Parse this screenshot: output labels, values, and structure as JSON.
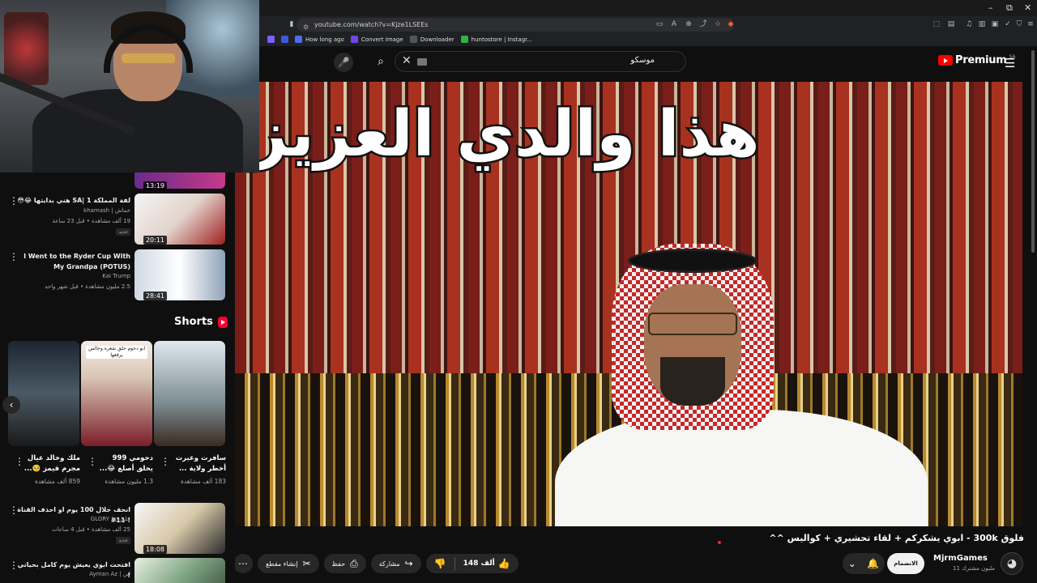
{
  "browser": {
    "url": "youtube.com/watch?v=Kjze1LSEEs",
    "bookmarks": [
      {
        "label": "",
        "color": "#7b61ff"
      },
      {
        "label": "",
        "color": "#3b5bdb"
      },
      {
        "label": "How long ago",
        "color": "#4c6ef5"
      },
      {
        "label": "Convert Image",
        "color": "#7048e8"
      },
      {
        "label": "Downloader",
        "color": "#555555"
      },
      {
        "label": "huntostore | Instagr...",
        "color": "#2fb344"
      }
    ]
  },
  "header": {
    "search_query": "موسكو",
    "logo_text": "Premium",
    "logo_region": "SA"
  },
  "video": {
    "caption": "هذا والدي العزيز",
    "title": "فلوق 300k - ابوي يشكركم + لقاء تحشيري + كواليس ^^",
    "like_count": "148 ألف",
    "share_label": "مشاركة",
    "save_label": "حفظ",
    "clip_label": "إنشاء مقطع"
  },
  "channel": {
    "name": "MjrmGames",
    "subscribers": "11 مليون مشترك",
    "join_label": "الانضمام"
  },
  "sidebar": {
    "partial_item": {
      "duration": "13:19"
    },
    "items": [
      {
        "title": "لفة المملكة 1 |SA هني بدايتها 😂😳",
        "channel": "خماش | khamash",
        "meta": "19 ألف مشاهدة • قبل 23 ساعة",
        "badge": "جديد",
        "duration": "20:11"
      },
      {
        "title": "I Went to the Ryder Cup With My Grandpa (POTUS)",
        "channel": "Kai Trump",
        "meta": "2.5 مليون مشاهدة • قبل شهر واحد",
        "badge": "",
        "duration": "28:41"
      },
      {
        "title": "انحف خلال 100 يوم او احذف القناة ! 11#",
        "channel": "جلوري | GLORY",
        "meta": "25 ألف مشاهدة • قبل 4 ساعات",
        "badge": "جديد",
        "duration": "18:08"
      },
      {
        "title": "افتحت ابوي يعيش يوم كامل بحياتي !",
        "channel": "ابن | Ayman Az",
        "meta": "",
        "badge": "",
        "duration": ""
      }
    ],
    "shorts_label": "Shorts",
    "shorts": [
      {
        "title": "سافرت وعبرت أخطر ولاية ...",
        "views": "183 ألف مشاهدة"
      },
      {
        "title": "دحومي 999 يحلق أصلع 😂...",
        "views": "1.3 مليون مشاهدة"
      },
      {
        "title": "ملك وخالد عيال مجرم قيمز 🥺...",
        "views": "859 ألف مشاهدة"
      }
    ],
    "short_overlay_text": "ابو دحوم حلق شعره وجالس يرقعها"
  }
}
